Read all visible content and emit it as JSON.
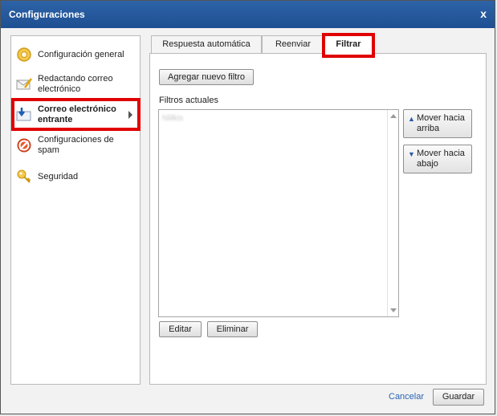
{
  "window": {
    "title": "Configuraciones",
    "close_label": "x"
  },
  "nav": {
    "items": [
      {
        "label": "Configuración general",
        "icon": "gear-icon"
      },
      {
        "label": "Redactando correo electrónico",
        "icon": "compose-icon"
      },
      {
        "label": "Correo electrónico entrante",
        "icon": "inbox-icon",
        "active": true
      },
      {
        "label": "Configuraciones de spam",
        "icon": "spam-icon"
      },
      {
        "label": "Seguridad",
        "icon": "key-icon"
      }
    ]
  },
  "tabs": [
    {
      "label": "Respuesta automática"
    },
    {
      "label": "Reenviar"
    },
    {
      "label": "Filtrar",
      "active": true
    }
  ],
  "filter_panel": {
    "add_button": "Agregar nuevo filtro",
    "current_label": "Filtros actuales",
    "list_items": [
      "Nlilkis"
    ],
    "move_up": "Mover hacia arriba",
    "move_down": "Mover hacia abajo",
    "edit_button": "Editar",
    "delete_button": "Eliminar"
  },
  "footer": {
    "cancel": "Cancelar",
    "save": "Guardar"
  },
  "colors": {
    "titlebar": "#1f4f92",
    "highlight": "#e00000",
    "link": "#2a63b5"
  }
}
